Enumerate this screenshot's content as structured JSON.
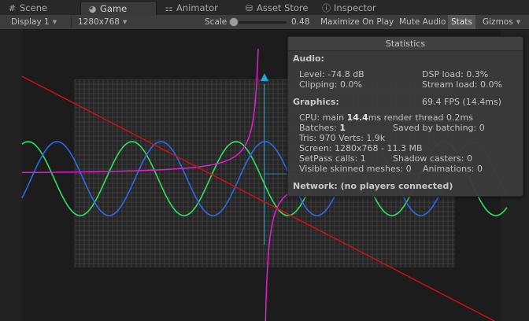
{
  "tabs": [
    {
      "label": "Scene",
      "icon": "scene-icon",
      "glyph": "#"
    },
    {
      "label": "Game",
      "icon": "game-icon",
      "glyph": "◕"
    },
    {
      "label": "Animator",
      "icon": "animator-icon",
      "glyph": "⚏"
    },
    {
      "label": "Asset Store",
      "icon": "asset-store-icon",
      "glyph": "⛁"
    },
    {
      "label": "Inspector",
      "icon": "inspector-icon",
      "glyph": "ⓘ"
    }
  ],
  "toolbar": {
    "display": "Display 1",
    "resolution": "1280x768",
    "scale_label": "Scale",
    "scale_value": "0.48",
    "maximize": "Maximize On Play",
    "mute": "Mute Audio",
    "stats": "Stats",
    "gizmos": "Gizmos"
  },
  "stats": {
    "title": "Statistics",
    "audio_head": "Audio:",
    "level": "Level: -74.8 dB",
    "dsp": "DSP load: 0.3%",
    "clipping": "Clipping: 0.0%",
    "stream": "Stream load: 0.0%",
    "graphics_head": "Graphics:",
    "fps": "69.4 FPS (14.4ms)",
    "cpu_prefix": "CPU: main ",
    "cpu_main": "14.4",
    "cpu_suffix": "ms  render thread 0.2ms",
    "batches_prefix": "Batches: ",
    "batches": "1",
    "saved": "Saved by batching: 0",
    "tris": "Tris: 970  Verts: 1.9k",
    "screen": "Screen: 1280x768 - 11.3 MB",
    "setpass": "SetPass calls: 1",
    "shadow": "Shadow casters: 0",
    "skinned": "Visible skinned meshes: 0",
    "animations": "Animations: 0",
    "network": "Network: (no players connected)"
  },
  "colors": {
    "red_line": "#d01010",
    "magenta_curve": "#e020d0",
    "green_wave": "#30e060",
    "blue_wave": "#2a6ae8",
    "cyan_axis": "#20a8d8",
    "grid": "#5a5a5a"
  }
}
